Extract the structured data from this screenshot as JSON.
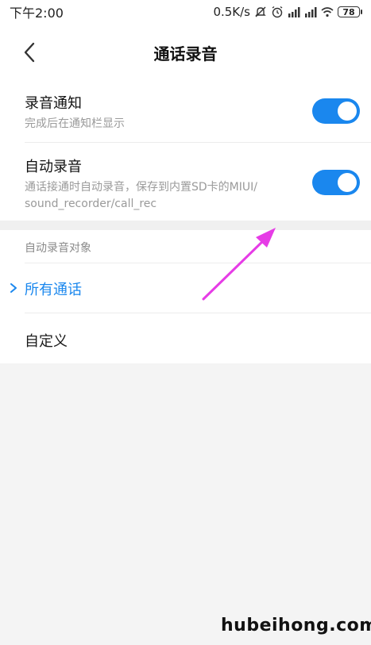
{
  "status_bar": {
    "time": "下午2:00",
    "speed": "0.5K/s",
    "battery": "78"
  },
  "header": {
    "title": "通话录音"
  },
  "settings": {
    "notify": {
      "title": "录音通知",
      "subtitle": "完成后在通知栏显示",
      "enabled": true
    },
    "auto_record": {
      "title": "自动录音",
      "subtitle_line1": "通话接通时自动录音，保存到内置SD卡的MIUI/",
      "subtitle_line2": "sound_recorder/call_rec",
      "enabled": true
    }
  },
  "target_section": {
    "label": "自动录音对象",
    "options": [
      {
        "label": "所有通话",
        "selected": true
      },
      {
        "label": "自定义",
        "selected": false
      }
    ]
  },
  "annotation": {
    "arrow_color": "#e63ce6"
  },
  "watermark": "hubeihong.com",
  "colors": {
    "accent": "#1a87ee"
  }
}
